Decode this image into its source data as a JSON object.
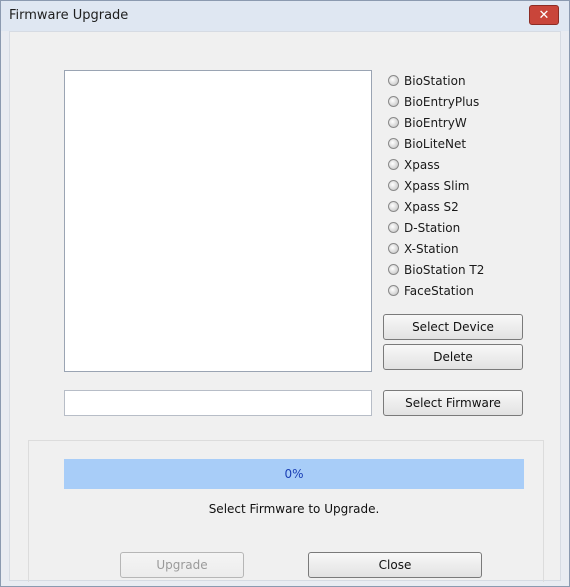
{
  "window": {
    "title": "Firmware Upgrade",
    "close_glyph": "✕"
  },
  "devices": {
    "options": [
      "BioStation",
      "BioEntryPlus",
      "BioEntryW",
      "BioLiteNet",
      "Xpass",
      "Xpass Slim",
      "Xpass S2",
      "D-Station",
      "X-Station",
      "BioStation T2",
      "FaceStation"
    ]
  },
  "buttons": {
    "select_device": "Select Device",
    "delete": "Delete",
    "select_firmware": "Select Firmware",
    "upgrade": "Upgrade",
    "close": "Close"
  },
  "firmware_path": {
    "value": "",
    "placeholder": ""
  },
  "progress": {
    "percent_label": "0%",
    "value": 0
  },
  "status_text": "Select Firmware to Upgrade."
}
